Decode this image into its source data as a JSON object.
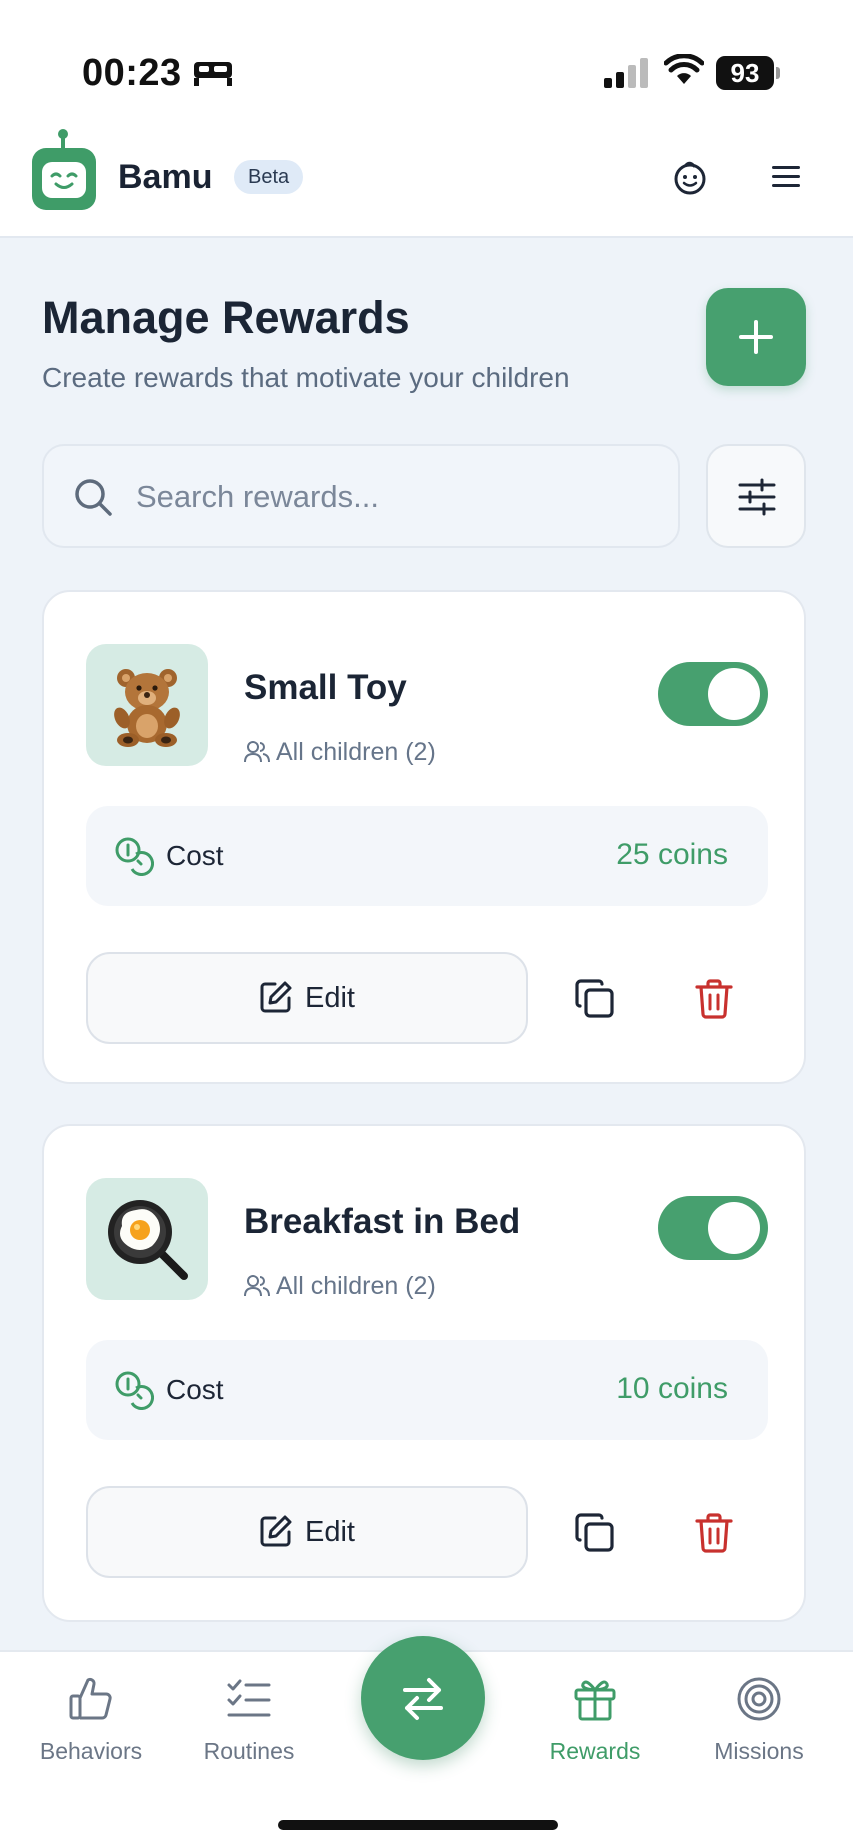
{
  "status_bar": {
    "time": "00:23",
    "battery": "93"
  },
  "header": {
    "brand": "Bamu",
    "badge": "Beta"
  },
  "page": {
    "title": "Manage Rewards",
    "subtitle": "Create rewards that motivate your children"
  },
  "search": {
    "placeholder": "Search rewards...",
    "value": ""
  },
  "rewards": [
    {
      "title": "Small Toy",
      "audience": "All children (2)",
      "enabled": true,
      "cost_label": "Cost",
      "cost_value": "25 coins",
      "edit_label": "Edit",
      "emoji": "teddy-bear"
    },
    {
      "title": "Breakfast in Bed",
      "audience": "All children (2)",
      "enabled": true,
      "cost_label": "Cost",
      "cost_value": "10 coins",
      "edit_label": "Edit",
      "emoji": "fried-egg-pan"
    }
  ],
  "bottom_nav": {
    "items": [
      {
        "label": "Behaviors",
        "icon": "thumbs-up-icon"
      },
      {
        "label": "Routines",
        "icon": "checklist-icon"
      },
      {
        "label": "Rewards",
        "icon": "gift-icon",
        "active": true
      },
      {
        "label": "Missions",
        "icon": "target-icon"
      }
    ],
    "center_icon": "swap-arrows-icon"
  },
  "colors": {
    "accent": "#47a06f",
    "danger": "#c8312e",
    "background": "#eef3f9"
  }
}
